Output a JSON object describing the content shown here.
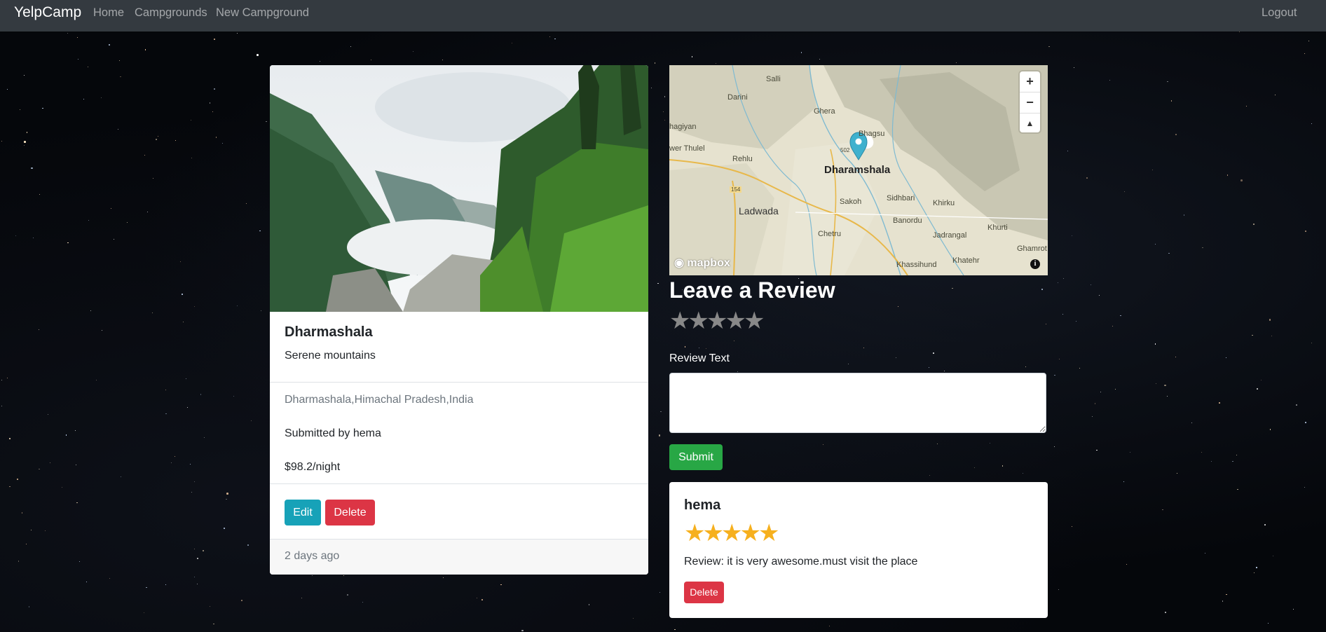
{
  "navbar": {
    "brand": "YelpCamp",
    "links": [
      "Home",
      "Campgrounds",
      "New Campground"
    ],
    "logout": "Logout"
  },
  "campground": {
    "title": "Dharmashala",
    "description": "Serene mountains",
    "location": "Dharmashala,Himachal Pradesh,India",
    "submitted_by": "Submitted by hema",
    "price": "$98.2/night",
    "edit_label": "Edit",
    "delete_label": "Delete",
    "age": "2 days ago"
  },
  "map": {
    "zoom_in": "+",
    "zoom_out": "−",
    "compass": "▲",
    "labels": [
      "Salli",
      "Darini",
      "Ghera",
      "hagiyan",
      "Bhagsu",
      "wer Thulel",
      "Rehlu",
      "Dharamshala",
      "Sakoh",
      "Sidhbari",
      "Khirku",
      "Ladwada",
      "Banordu",
      "Khurti",
      "Jadrangal",
      "Chetru",
      "Ghamrot",
      "Khassihund",
      "Khatehr",
      "502",
      "154"
    ],
    "logo_text": "mapbox",
    "info_icon": "i"
  },
  "review_form": {
    "heading": "Leave a Review",
    "rating_max": 5,
    "rating_selected": 0,
    "star_glyph": "★",
    "text_label": "Review Text",
    "text_value": "",
    "submit_label": "Submit"
  },
  "reviews": [
    {
      "author": "hema",
      "rating": 5,
      "text": "Review: it is very awesome.must visit the place",
      "delete_label": "Delete"
    }
  ],
  "colors": {
    "navbar": "#343a40",
    "edit": "#17a2b8",
    "delete": "#dc3545",
    "submit": "#28a745",
    "star_filled": "#f6b01e",
    "star_empty": "#888888"
  }
}
